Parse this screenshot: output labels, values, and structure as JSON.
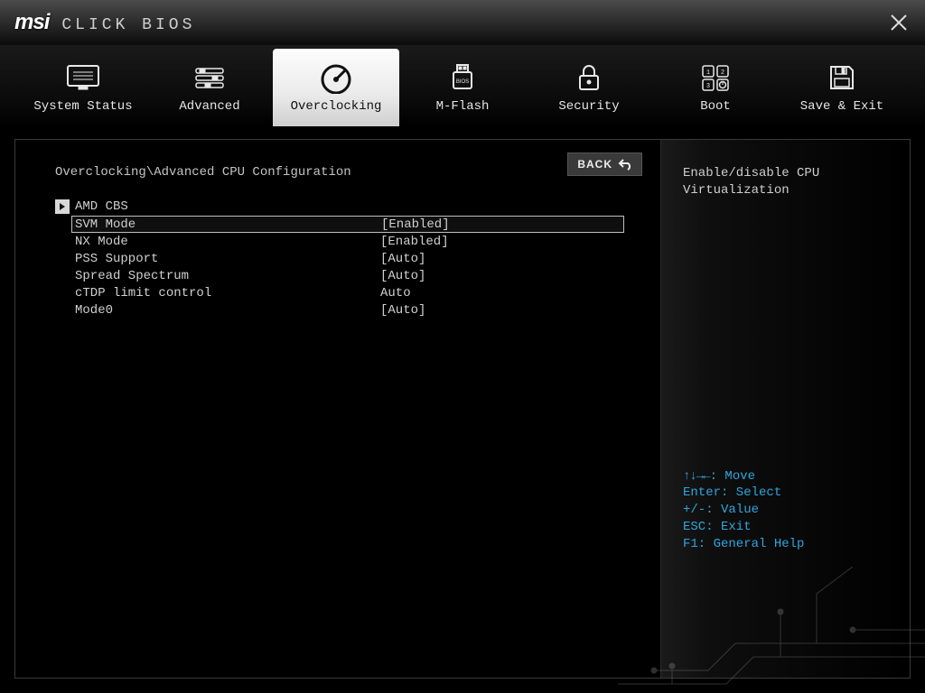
{
  "brand": {
    "logo": "msi",
    "title": "CLICK BIOS"
  },
  "close_label": "Close",
  "nav": {
    "items": [
      {
        "id": "system-status",
        "label": "System Status",
        "icon": "monitor-list-icon"
      },
      {
        "id": "advanced",
        "label": "Advanced",
        "icon": "sliders-icon"
      },
      {
        "id": "overclocking",
        "label": "Overclocking",
        "icon": "gauge-icon",
        "active": true
      },
      {
        "id": "m-flash",
        "label": "M-Flash",
        "icon": "usb-bios-icon"
      },
      {
        "id": "security",
        "label": "Security",
        "icon": "lock-icon"
      },
      {
        "id": "boot",
        "label": "Boot",
        "icon": "keypad-power-icon"
      },
      {
        "id": "save-exit",
        "label": "Save & Exit",
        "icon": "floppy-icon"
      }
    ]
  },
  "page": {
    "breadcrumb": "Overclocking\\Advanced CPU Configuration",
    "back_label": "BACK",
    "submenu": {
      "label": "AMD CBS"
    },
    "settings": [
      {
        "name": "SVM Mode",
        "value": "[Enabled]",
        "selected": true
      },
      {
        "name": "NX Mode",
        "value": "[Enabled]"
      },
      {
        "name": "PSS Support",
        "value": "[Auto]"
      },
      {
        "name": "Spread Spectrum",
        "value": "[Auto]"
      },
      {
        "name": "cTDP limit control",
        "value": "Auto"
      },
      {
        "name": "Mode0",
        "value": "[Auto]"
      }
    ]
  },
  "sidebar": {
    "help_line1": "Enable/disable CPU",
    "help_line2": "Virtualization",
    "hints": {
      "arrows": "↑↓→←",
      "move": ": Move",
      "enter": "Enter: Select",
      "plus": "+/-: Value",
      "esc": "ESC: Exit",
      "f1": "F1: General Help"
    }
  },
  "colors": {
    "accent": "#2ea6e0"
  }
}
